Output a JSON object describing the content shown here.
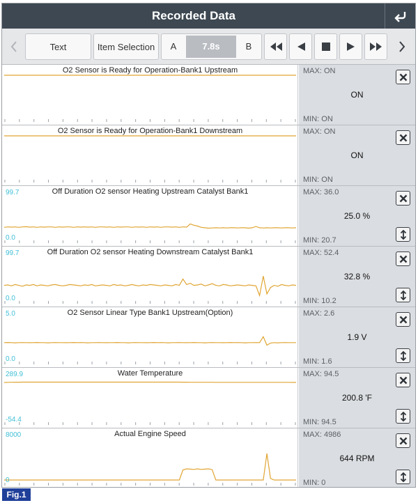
{
  "header": {
    "title": "Recorded Data",
    "back_icon": "return-arrow-icon"
  },
  "toolbar": {
    "text_label": "Text",
    "item_selection_label": "Item Selection",
    "marker_a": "A",
    "marker_b": "B",
    "time": "7.8s",
    "prev_icon": "chevron-left-icon",
    "next_icon": "chevron-right-icon",
    "playback_icons": [
      "fast-rewind-icon",
      "step-back-icon",
      "stop-icon",
      "play-icon",
      "fast-forward-icon"
    ]
  },
  "colors": {
    "trace": "#e0a533",
    "axis_value": "#3fbfd6",
    "header_bg": "#3d4852",
    "panel_bg": "#dadde1"
  },
  "items": [
    {
      "title": "O2 Sensor is Ready for Operation-Bank1 Upstream",
      "max": "MAX: ON",
      "current": "ON",
      "min": "MIN: ON",
      "ymax": "",
      "ymin": "",
      "scalable": false,
      "series": [
        1,
        1,
        1,
        1,
        1,
        1,
        1,
        1,
        1,
        1,
        1,
        1,
        1,
        1,
        1,
        1,
        1,
        1,
        1,
        1,
        1,
        1,
        1,
        1,
        1,
        1,
        1,
        1,
        1,
        1,
        1,
        1,
        1,
        1,
        1,
        1,
        1,
        1,
        1,
        1,
        1,
        1,
        1,
        1,
        1,
        1,
        1,
        1,
        1,
        1,
        1,
        1,
        1,
        1,
        1,
        1,
        1,
        1,
        1,
        1,
        1,
        1,
        1,
        1,
        1,
        1,
        1,
        1,
        1,
        1,
        1,
        1,
        1,
        1,
        1,
        1,
        1,
        1,
        1,
        1,
        1
      ]
    },
    {
      "title": "O2 Sensor is Ready for Operation-Bank1 Downstream",
      "max": "MAX: ON",
      "current": "ON",
      "min": "MIN: ON",
      "ymax": "",
      "ymin": "",
      "scalable": false,
      "series": [
        1,
        1,
        1,
        1,
        1,
        1,
        1,
        1,
        1,
        1,
        1,
        1,
        1,
        1,
        1,
        1,
        1,
        1,
        1,
        1,
        1,
        1,
        1,
        1,
        1,
        1,
        1,
        1,
        1,
        1,
        1,
        1,
        1,
        1,
        1,
        1,
        1,
        1,
        1,
        1,
        1,
        1,
        1,
        1,
        1,
        1,
        1,
        1,
        1,
        1,
        1,
        1,
        1,
        1,
        1,
        1,
        1,
        1,
        1,
        1,
        1,
        1,
        1,
        1,
        1,
        1,
        1,
        1,
        1,
        1,
        1,
        1,
        1,
        1,
        1,
        1,
        1,
        1,
        1,
        1,
        1
      ]
    },
    {
      "title": "Off Duration O2 sensor Heating Upstream Catalyst Bank1",
      "max": "MAX: 36.0",
      "current": "25.0 %",
      "min": "MIN: 20.7",
      "ymax": "99.7",
      "ymin": "0.0",
      "scalable": true,
      "range": [
        0,
        99.7
      ],
      "series": [
        24,
        25,
        24.5,
        25,
        24,
        25,
        25.5,
        24.5,
        25,
        24,
        25,
        24.5,
        25,
        25,
        24,
        25,
        24.5,
        25,
        25,
        24,
        25,
        24.5,
        25,
        24.5,
        25,
        24,
        25,
        25,
        24.5,
        25,
        24,
        25,
        24.5,
        25,
        25,
        24,
        25,
        24.5,
        25,
        24,
        25,
        24.5,
        25,
        24,
        25,
        25,
        24.5,
        25,
        24,
        25,
        24.5,
        32,
        29,
        27,
        24,
        23,
        22,
        22.5,
        23,
        22.5,
        23,
        22.5,
        23,
        23,
        22.5,
        23,
        23,
        22,
        23,
        26,
        23,
        22.5,
        23,
        22.5,
        23,
        23,
        22.5,
        23,
        23,
        22.5,
        23
      ]
    },
    {
      "title": "Off Duration O2 sensor Heating Downstream Catalyst Bank1",
      "max": "MAX: 52.4",
      "current": "32.8 %",
      "min": "MIN: 10.2",
      "ymax": "99.7",
      "ymin": "0.0",
      "scalable": true,
      "range": [
        0,
        99.7
      ],
      "series": [
        30,
        31,
        29,
        32,
        30,
        28,
        31,
        30,
        32,
        29,
        31,
        30,
        29,
        31,
        32,
        30,
        29,
        30,
        32,
        31,
        30,
        29,
        31,
        30,
        32,
        29,
        30,
        31,
        30,
        29,
        32,
        30,
        31,
        29,
        30,
        32,
        30,
        29,
        31,
        30,
        32,
        31,
        30,
        29,
        31,
        30,
        29,
        32,
        30,
        45,
        32,
        35,
        30,
        31,
        33,
        29,
        31,
        34,
        30,
        29,
        32,
        31,
        29,
        30,
        31,
        30,
        29,
        31,
        30,
        29,
        6,
        52,
        10,
        25,
        30,
        28,
        32,
        30,
        29,
        31,
        30
      ]
    },
    {
      "title": "O2 Sensor Linear Type Bank1 Upstream(Option)",
      "max": "MAX: 2.6",
      "current": "1.9 V",
      "min": "MIN: 1.6",
      "ymax": "5.0",
      "ymin": "0.0",
      "scalable": true,
      "range": [
        0,
        5.0
      ],
      "series": [
        1.9,
        1.92,
        1.9,
        1.88,
        1.9,
        1.91,
        1.9,
        1.89,
        1.9,
        1.92,
        1.9,
        1.9,
        1.88,
        1.9,
        1.91,
        1.9,
        1.9,
        1.89,
        1.9,
        1.92,
        1.9,
        1.91,
        1.9,
        1.88,
        1.9,
        1.9,
        1.91,
        1.9,
        1.89,
        1.9,
        1.9,
        1.92,
        1.9,
        1.9,
        1.88,
        1.9,
        1.91,
        1.9,
        1.9,
        1.89,
        1.9,
        1.92,
        1.9,
        1.91,
        1.9,
        1.88,
        1.9,
        1.9,
        1.91,
        1.9,
        1.89,
        1.9,
        1.92,
        1.9,
        1.9,
        1.88,
        1.9,
        1.91,
        1.9,
        1.9,
        1.89,
        1.9,
        1.92,
        1.9,
        1.91,
        1.9,
        1.88,
        1.9,
        1.9,
        1.91,
        1.9,
        2.6,
        1.6,
        1.85,
        1.9,
        1.88,
        1.9,
        1.91,
        1.9,
        1.9,
        1.9
      ]
    },
    {
      "title": "Water Temperature",
      "max": "MAX: 94.5",
      "current": "200.8 'F",
      "min": "MIN: 94.5",
      "ymax": "289.9",
      "ymin": "-54.4",
      "scalable": true,
      "range": [
        -54.4,
        289.9
      ],
      "series": [
        245,
        246,
        246.5,
        247,
        247,
        247.5,
        247.5,
        247.5,
        247.5,
        247.5,
        247.5,
        247.5,
        247.5,
        247.5,
        247.5,
        247.5,
        247.5,
        247.5,
        247.5,
        247.5,
        247.5,
        247.5,
        247.5,
        247.5,
        247.5,
        247.5,
        247.5,
        247.5,
        247.5,
        247.5,
        247.5,
        247.5,
        247.5,
        247.5,
        247.5,
        247.5,
        247.5,
        247.5,
        247.5,
        247.5,
        247.5,
        247.5,
        247.5,
        247.5,
        247.5,
        247.5,
        247.5,
        247.5,
        247.5,
        247,
        247,
        246.5,
        246.5,
        246.5,
        246.5,
        246.5,
        246.5,
        246.5,
        246,
        246,
        246,
        246,
        246,
        246,
        246,
        246,
        246,
        246,
        246,
        246,
        246,
        246,
        246,
        246,
        246,
        246,
        246,
        246,
        246,
        245.5,
        245.5
      ]
    },
    {
      "title": "Actual Engine Speed",
      "max": "MAX: 4986",
      "current": "644 RPM",
      "min": "MIN: 0",
      "ymax": "8000",
      "ymin": "0",
      "scalable": true,
      "range": [
        0,
        8000
      ],
      "series": [
        0,
        0,
        0,
        0,
        0,
        0,
        0,
        0,
        0,
        0,
        0,
        0,
        0,
        0,
        0,
        0,
        0,
        0,
        0,
        0,
        0,
        0,
        0,
        0,
        0,
        0,
        0,
        0,
        0,
        0,
        0,
        0,
        0,
        0,
        0,
        0,
        0,
        0,
        0,
        0,
        0,
        0,
        0,
        0,
        0,
        0,
        0,
        0,
        0,
        1900,
        2100,
        2050,
        2000,
        2100,
        2000,
        2050,
        2100,
        1950,
        0,
        0,
        0,
        0,
        0,
        0,
        0,
        0,
        0,
        0,
        0,
        0,
        0,
        0,
        4986,
        300,
        0,
        0,
        0,
        0,
        0,
        0,
        0
      ]
    }
  ]
}
